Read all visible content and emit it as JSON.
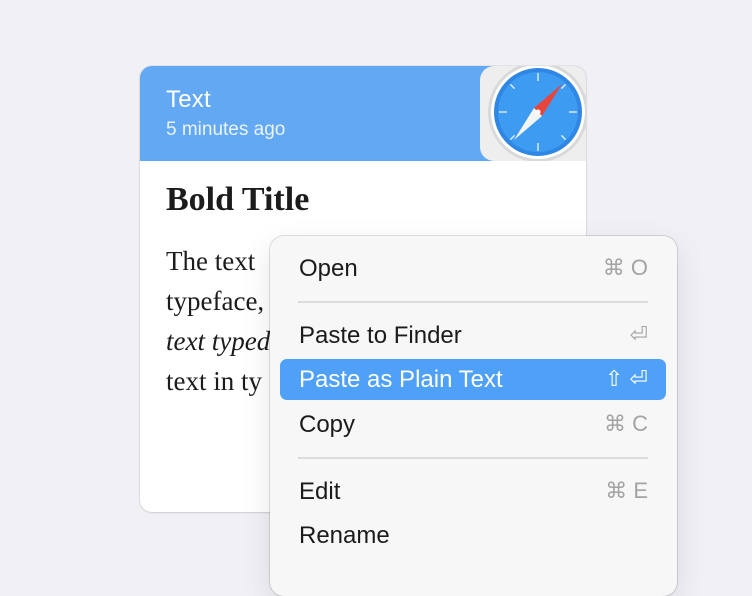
{
  "card": {
    "type_label": "Text",
    "timestamp": "5 minutes ago",
    "app_icon": "safari-compass-icon",
    "header_color": "#62a8f2",
    "content": {
      "title": "Bold Title",
      "lines": [
        "The text",
        "typeface,",
        "text typed",
        "text in ty"
      ]
    }
  },
  "menu": {
    "items": [
      {
        "label": "Open",
        "shortcut": "⌘ O"
      },
      {
        "label": "Paste to Finder",
        "shortcut": "⏎"
      },
      {
        "label": "Paste as Plain Text",
        "shortcut": "⇧ ⏎",
        "selected": true
      },
      {
        "label": "Copy",
        "shortcut": "⌘ C"
      },
      {
        "label": "Edit",
        "shortcut": "⌘ E"
      },
      {
        "label": "Rename",
        "shortcut": ""
      }
    ],
    "highlight_color": "#4fa0f7"
  }
}
